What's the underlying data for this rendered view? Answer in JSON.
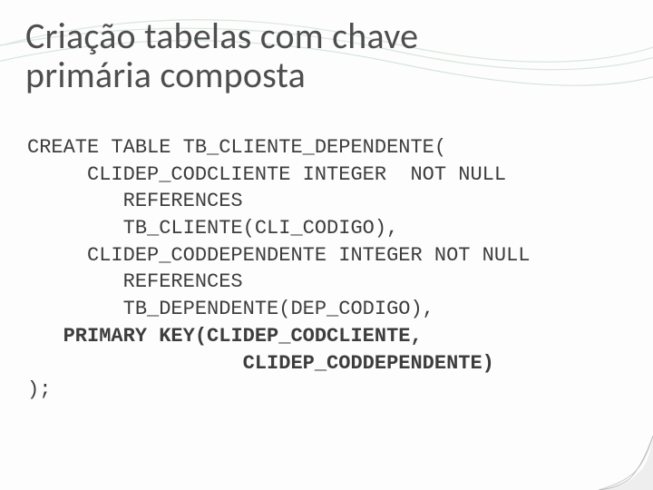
{
  "title_line1": "Criação tabelas com chave",
  "title_line2": "primária composta",
  "code": {
    "l1": "CREATE TABLE TB_CLIENTE_DEPENDENTE(",
    "l2": "     CLIDEP_CODCLIENTE INTEGER  NOT NULL",
    "l3": "        REFERENCES",
    "l4": "        TB_CLIENTE(CLI_CODIGO),",
    "l5": "     CLIDEP_CODDEPENDENTE INTEGER NOT NULL",
    "l6": "        REFERENCES",
    "l7": "        TB_DEPENDENTE(DEP_CODIGO),",
    "l8a": "   ",
    "l8b": "PRIMARY KEY(CLIDEP_CODCLIENTE,",
    "l9a": "                  ",
    "l9b": "CLIDEP_CODDEPENDENTE)",
    "l10": ");"
  }
}
